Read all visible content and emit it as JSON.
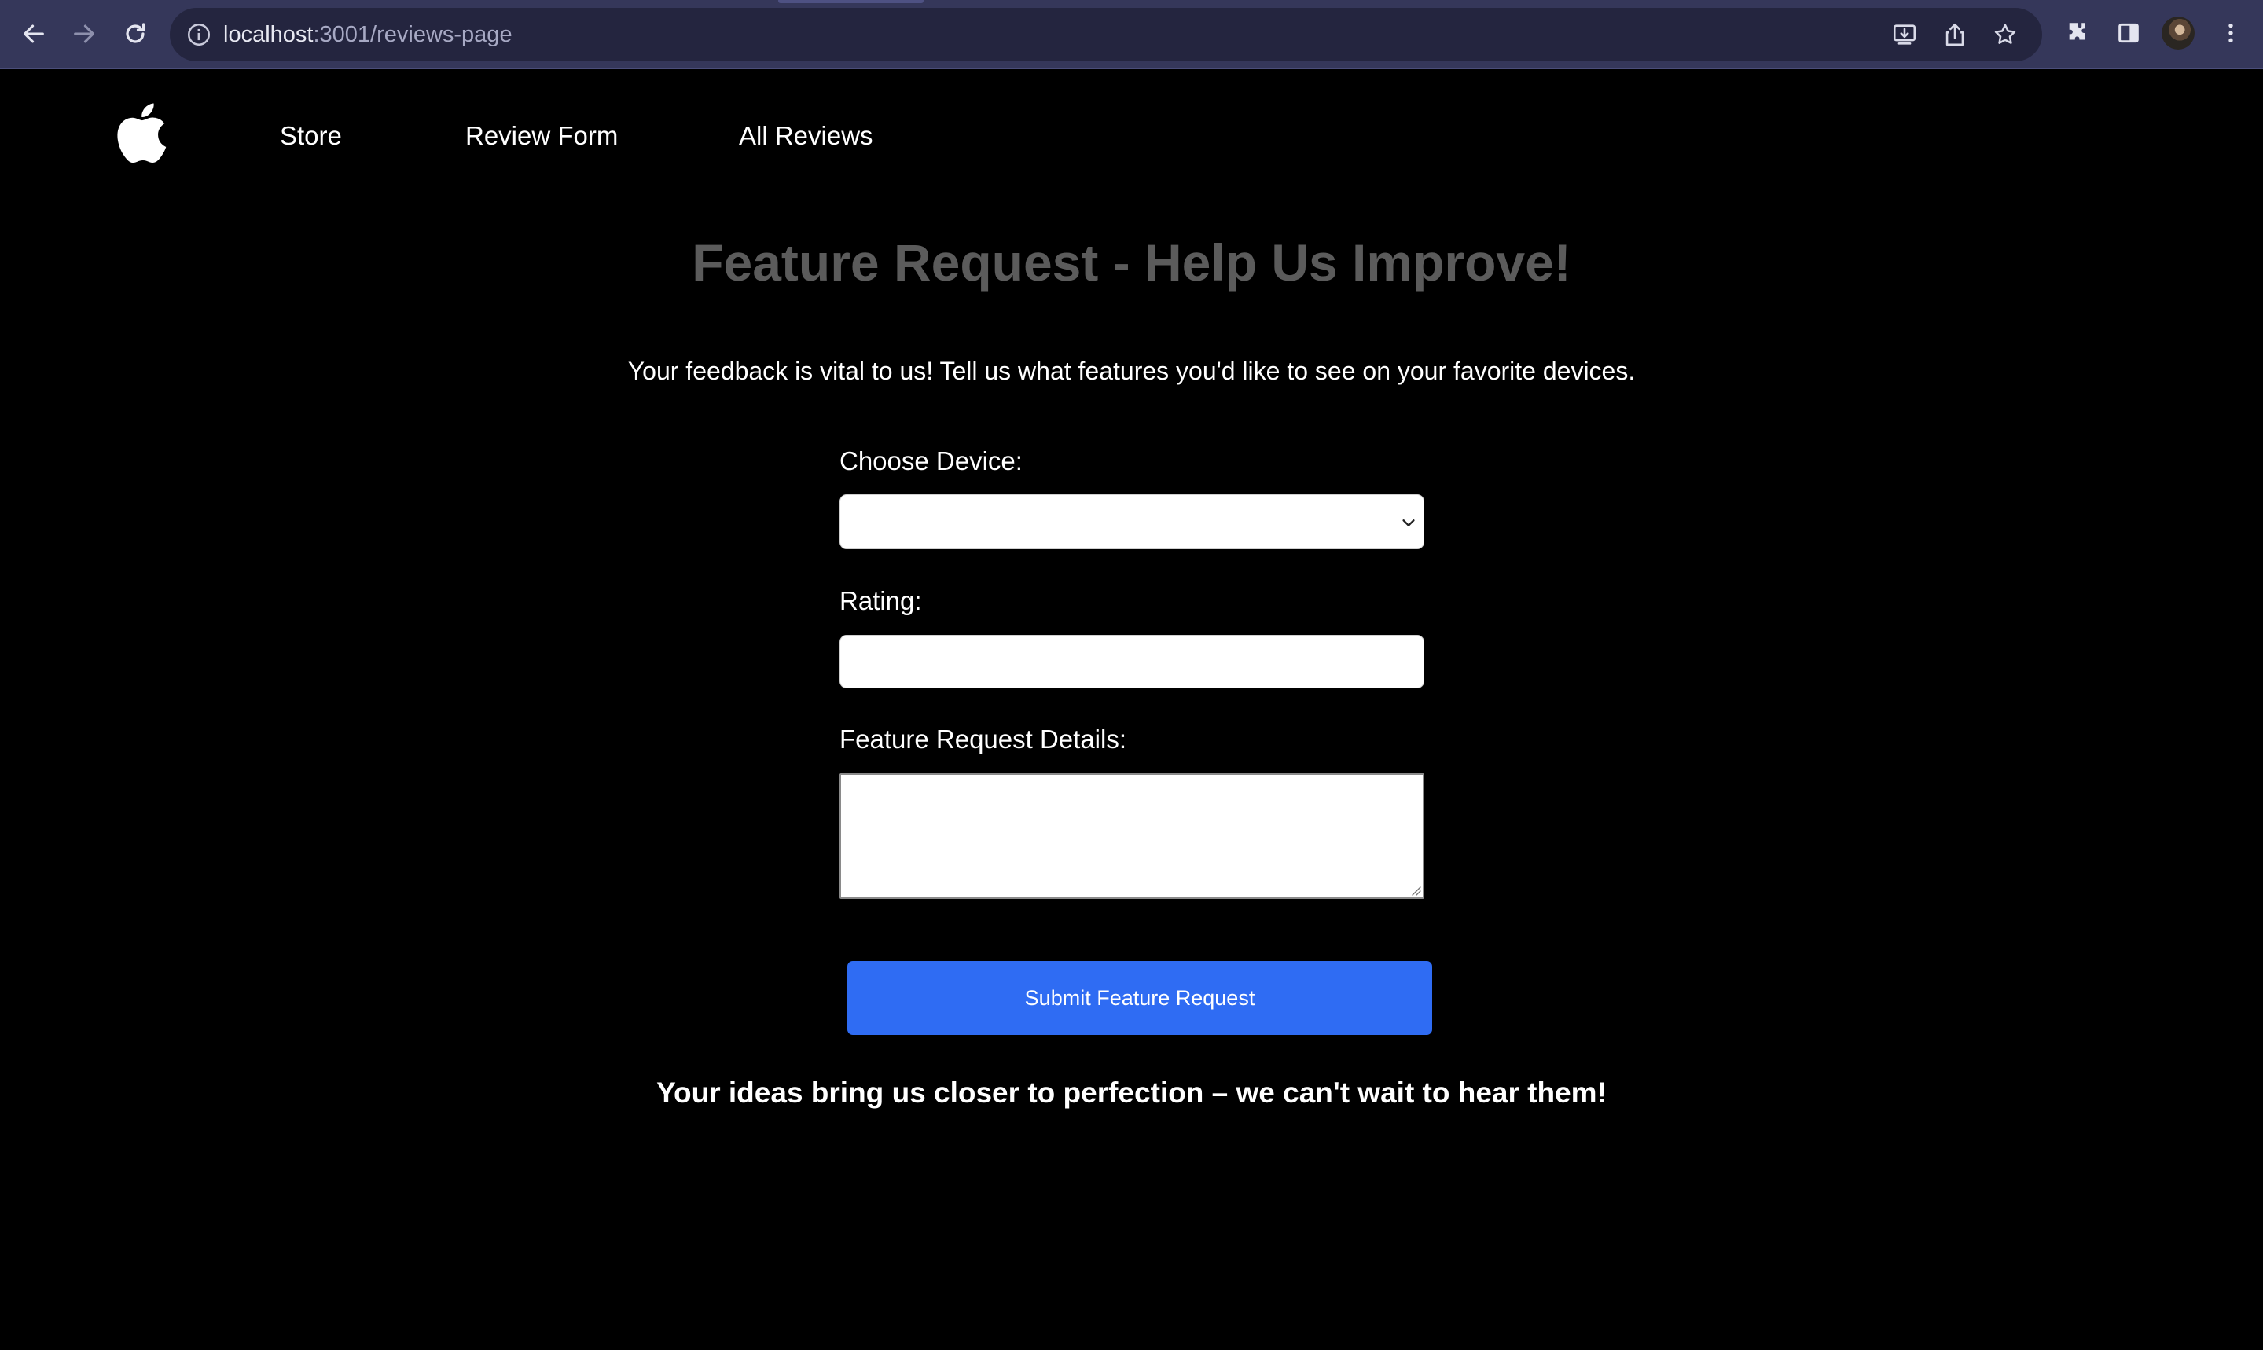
{
  "browser": {
    "url_host": "localhost",
    "url_path": ":3001/reviews-page",
    "icons": [
      "back-arrow-icon",
      "forward-arrow-icon",
      "reload-icon",
      "info-icon",
      "install-icon",
      "share-icon",
      "bookmark-star-icon",
      "extensions-icon",
      "side-panel-icon",
      "profile-avatar",
      "kebab-menu-icon"
    ]
  },
  "site_nav": {
    "logo": "apple-logo-icon",
    "links": [
      "Store",
      "Review Form",
      "All Reviews"
    ]
  },
  "main": {
    "title": "Feature Request - Help Us Improve!",
    "intro": "Your feedback is vital to us! Tell us what features you'd like to see on your favorite devices.",
    "device_label": "Choose Device:",
    "device_value": "",
    "rating_label": "Rating:",
    "rating_value": "",
    "details_label": "Feature Request Details:",
    "details_value": "",
    "submit_label": "Submit Feature Request",
    "closing": "Your ideas bring us closer to perfection – we can't wait to hear them!"
  },
  "colors": {
    "chrome_bg": "#35375a",
    "omnibox_bg": "#24253f",
    "page_bg": "#000000",
    "title": "#5b5b5b",
    "button": "#2f6cf3"
  }
}
